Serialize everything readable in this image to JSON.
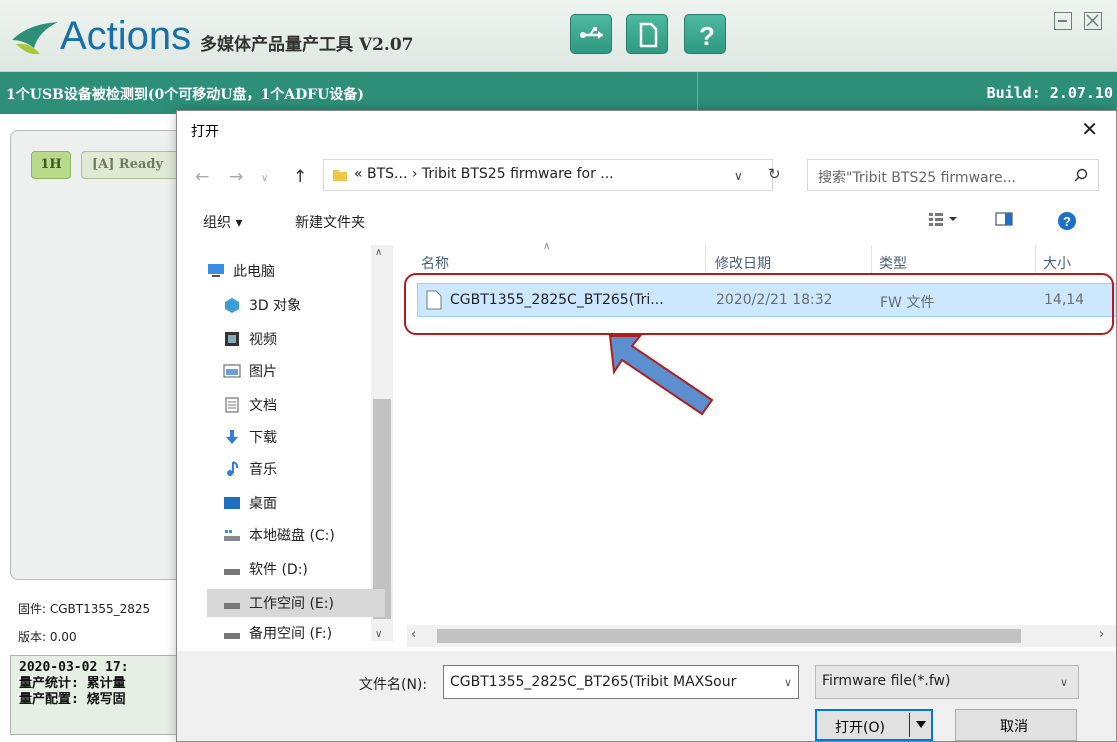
{
  "app": {
    "brand": "Actions",
    "subtitle": "多媒体产品量产工具 V2.07",
    "status_left": "1个USB设备被检测到(0个可移动U盘，1个ADFU设备)",
    "status_right": "Build: 2.07.10",
    "device_slot": "1H",
    "device_state": "[A] Ready",
    "firmware_line": "固件: CGBT1355_2825",
    "version_line": "版本: 0.00",
    "log_lines": [
      "2020-03-02 17:",
      "量产统计: 累计量",
      "量产配置: 烧写固"
    ]
  },
  "dialog": {
    "title": "打开",
    "address": "« BTS...  ›  Tribit BTS25 firmware for ...",
    "search_placeholder": "搜索\"Tribit BTS25 firmware...",
    "organize": "组织 ▾",
    "new_folder": "新建文件夹",
    "nav_items": [
      {
        "label": "此电脑",
        "icon": "computer-icon"
      },
      {
        "label": "3D 对象",
        "icon": "cube-icon"
      },
      {
        "label": "视频",
        "icon": "video-icon"
      },
      {
        "label": "图片",
        "icon": "picture-icon"
      },
      {
        "label": "文档",
        "icon": "document-icon"
      },
      {
        "label": "下载",
        "icon": "download-icon"
      },
      {
        "label": "音乐",
        "icon": "music-icon"
      },
      {
        "label": "桌面",
        "icon": "desktop-icon"
      },
      {
        "label": "本地磁盘 (C:)",
        "icon": "drive-icon"
      },
      {
        "label": "软件 (D:)",
        "icon": "drive-icon"
      },
      {
        "label": "工作空间 (E:)",
        "icon": "drive-icon"
      },
      {
        "label": "备用空间 (F:)",
        "icon": "drive-icon"
      }
    ],
    "columns": {
      "name": "名称",
      "modified": "修改日期",
      "type": "类型",
      "size": "大小"
    },
    "files": [
      {
        "name": "CGBT1355_2825C_BT265(Tri...",
        "modified": "2020/2/21 18:32",
        "type": "FW 文件",
        "size": "14,14"
      }
    ],
    "filename_label": "文件名(N):",
    "filename_value": "CGBT1355_2825C_BT265(Tribit MAXSour",
    "filter": "Firmware file(*.fw)",
    "open_button": "打开(O)",
    "cancel_button": "取消"
  },
  "colors": {
    "accent": "#0078d7",
    "app_green": "#2d8f78",
    "highlight": "#b11d1d",
    "annotation_arrow": "#5b8fd0"
  }
}
